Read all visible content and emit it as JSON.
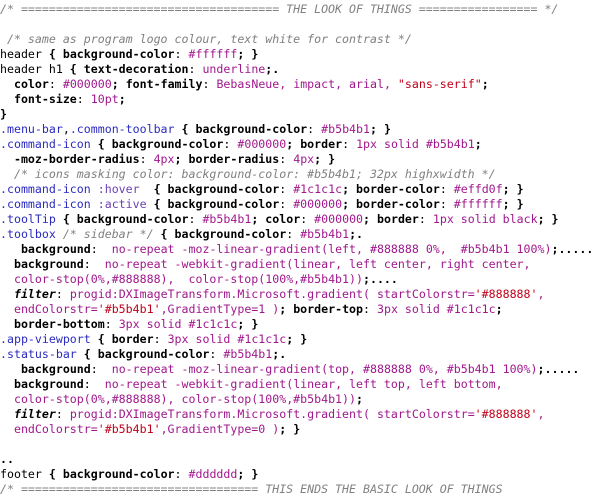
{
  "colors": {
    "comment": "#808080",
    "class_selector": "#2b2bbf",
    "pseudo": "#6a3fb5",
    "value": "#a0188d",
    "string": "#c0001a",
    "background": "#ffffff"
  },
  "lines": [
    [
      [
        "comment",
        "/* ===================================== THE LOOK OF THINGS ================= */"
      ]
    ],
    [],
    [
      [
        "plain",
        " "
      ],
      [
        "comment",
        "/* same as program logo colour, text white for contrast */"
      ]
    ],
    [
      [
        "selector",
        "header"
      ],
      [
        "punct",
        " { "
      ],
      [
        "prop",
        "background-color"
      ],
      [
        "plain",
        ": "
      ],
      [
        "value",
        "#ffffff"
      ],
      [
        "punct",
        "; }"
      ]
    ],
    [
      [
        "selector",
        "header h1"
      ],
      [
        "punct",
        " { "
      ],
      [
        "prop",
        "text-decoration"
      ],
      [
        "plain",
        ": "
      ],
      [
        "value",
        "underline"
      ],
      [
        "punct",
        ";"
      ],
      [
        "ws-dots",
        "."
      ]
    ],
    [
      [
        "plain",
        "  "
      ],
      [
        "prop",
        "color"
      ],
      [
        "plain",
        ": "
      ],
      [
        "value",
        "#000000"
      ],
      [
        "punct",
        "; "
      ],
      [
        "prop",
        "font-family"
      ],
      [
        "plain",
        ": "
      ],
      [
        "value",
        "BebasNeue, impact, arial, "
      ],
      [
        "string",
        "\"sans-serif\""
      ],
      [
        "punct",
        ";"
      ]
    ],
    [
      [
        "plain",
        "  "
      ],
      [
        "prop",
        "font-size"
      ],
      [
        "plain",
        ": "
      ],
      [
        "value",
        "10pt"
      ],
      [
        "punct",
        ";"
      ]
    ],
    [
      [
        "punct",
        "}"
      ]
    ],
    [
      [
        "class",
        ".menu-bar"
      ],
      [
        "plain",
        ","
      ],
      [
        "class",
        ".common-toolbar"
      ],
      [
        "punct",
        " { "
      ],
      [
        "prop",
        "background-color"
      ],
      [
        "plain",
        ": "
      ],
      [
        "value",
        "#b5b4b1"
      ],
      [
        "punct",
        "; }"
      ]
    ],
    [
      [
        "class",
        ".command-icon"
      ],
      [
        "punct",
        " { "
      ],
      [
        "prop",
        "background-color"
      ],
      [
        "plain",
        ": "
      ],
      [
        "value",
        "#000000"
      ],
      [
        "punct",
        "; "
      ],
      [
        "prop",
        "border"
      ],
      [
        "plain",
        ": "
      ],
      [
        "value",
        "1px solid #b5b4b1"
      ],
      [
        "punct",
        ";"
      ]
    ],
    [
      [
        "plain",
        "  "
      ],
      [
        "prop",
        "-moz-border-radius"
      ],
      [
        "plain",
        ": "
      ],
      [
        "value",
        "4px"
      ],
      [
        "punct",
        "; "
      ],
      [
        "prop",
        "border-radius"
      ],
      [
        "plain",
        ": "
      ],
      [
        "value",
        "4px"
      ],
      [
        "punct",
        "; }"
      ]
    ],
    [
      [
        "plain",
        "  "
      ],
      [
        "comment",
        "/* icons masking color: background-color: #b5b4b1; 32px highxwidth */"
      ]
    ],
    [
      [
        "class",
        ".command-icon"
      ],
      [
        "pseudo",
        " :hover"
      ],
      [
        "punct",
        "  { "
      ],
      [
        "prop",
        "background-color"
      ],
      [
        "plain",
        ": "
      ],
      [
        "value",
        "#1c1c1c"
      ],
      [
        "punct",
        "; "
      ],
      [
        "prop",
        "border-color"
      ],
      [
        "plain",
        ": "
      ],
      [
        "value",
        "#effd0f"
      ],
      [
        "punct",
        "; }"
      ]
    ],
    [
      [
        "class",
        ".command-icon"
      ],
      [
        "pseudo",
        " :active"
      ],
      [
        "punct",
        " { "
      ],
      [
        "prop",
        "background-color"
      ],
      [
        "plain",
        ": "
      ],
      [
        "value",
        "#000000"
      ],
      [
        "punct",
        "; "
      ],
      [
        "prop",
        "border-color"
      ],
      [
        "plain",
        ": "
      ],
      [
        "value",
        "#ffffff"
      ],
      [
        "punct",
        "; }"
      ]
    ],
    [
      [
        "class",
        ".toolTip"
      ],
      [
        "punct",
        " { "
      ],
      [
        "prop",
        "background-color"
      ],
      [
        "plain",
        ": "
      ],
      [
        "value",
        "#b5b4b1"
      ],
      [
        "punct",
        "; "
      ],
      [
        "prop",
        "color"
      ],
      [
        "plain",
        ": "
      ],
      [
        "value",
        "#000000"
      ],
      [
        "punct",
        "; "
      ],
      [
        "prop",
        "border"
      ],
      [
        "plain",
        ": "
      ],
      [
        "value",
        "1px solid black"
      ],
      [
        "punct",
        "; }"
      ]
    ],
    [
      [
        "class",
        ".toolbox"
      ],
      [
        "plain",
        " "
      ],
      [
        "comment",
        "/* sidebar */"
      ],
      [
        "punct",
        " { "
      ],
      [
        "prop",
        "background-color"
      ],
      [
        "plain",
        ": "
      ],
      [
        "value",
        "#b5b4b1"
      ],
      [
        "punct",
        ";"
      ],
      [
        "ws-dots",
        "."
      ]
    ],
    [
      [
        "plain",
        "   "
      ],
      [
        "prop",
        "background"
      ],
      [
        "plain",
        ":  "
      ],
      [
        "value",
        "no-repeat -moz-linear-gradient(left, #888888 0%,  #b5b4b1 100%)"
      ],
      [
        "punct",
        ";"
      ],
      [
        "ws-dots",
        "....."
      ]
    ],
    [
      [
        "plain",
        "  "
      ],
      [
        "prop",
        "background"
      ],
      [
        "plain",
        ":  "
      ],
      [
        "value",
        "no-repeat -webkit-gradient(linear, left center, right center,"
      ]
    ],
    [
      [
        "plain",
        "  "
      ],
      [
        "value",
        "color-stop(0%,#888888),  color-stop(100%,#b5b4b1))"
      ],
      [
        "punct",
        ";"
      ],
      [
        "ws-dots",
        "...."
      ]
    ],
    [
      [
        "plain",
        "  "
      ],
      [
        "prop-italic",
        "filter"
      ],
      [
        "plain",
        ": "
      ],
      [
        "value",
        "progid:DXImageTransform.Microsoft.gradient( startColorstr="
      ],
      [
        "string",
        "'#888888'"
      ],
      [
        "value",
        ","
      ]
    ],
    [
      [
        "plain",
        "  "
      ],
      [
        "value",
        "endColorstr="
      ],
      [
        "string",
        "'#b5b4b1'"
      ],
      [
        "value",
        ",GradientType=1 )"
      ],
      [
        "punct",
        "; "
      ],
      [
        "prop",
        "border-top"
      ],
      [
        "plain",
        ": "
      ],
      [
        "value",
        "3px solid #1c1c1c"
      ],
      [
        "punct",
        ";"
      ]
    ],
    [
      [
        "plain",
        "  "
      ],
      [
        "prop",
        "border-bottom"
      ],
      [
        "plain",
        ": "
      ],
      [
        "value",
        "3px solid #1c1c1c"
      ],
      [
        "punct",
        "; }"
      ]
    ],
    [
      [
        "class",
        ".app-viewport"
      ],
      [
        "punct",
        " { "
      ],
      [
        "prop",
        "border"
      ],
      [
        "plain",
        ": "
      ],
      [
        "value",
        "3px solid #1c1c1c"
      ],
      [
        "punct",
        "; }"
      ]
    ],
    [
      [
        "class",
        ".status-bar"
      ],
      [
        "punct",
        " { "
      ],
      [
        "prop",
        "background-color"
      ],
      [
        "plain",
        ": "
      ],
      [
        "value",
        "#b5b4b1"
      ],
      [
        "punct",
        ";"
      ],
      [
        "ws-dots",
        "."
      ]
    ],
    [
      [
        "plain",
        "   "
      ],
      [
        "prop",
        "background"
      ],
      [
        "plain",
        ":  "
      ],
      [
        "value",
        "no-repeat -moz-linear-gradient(top, #888888 0%, #b5b4b1 100%)"
      ],
      [
        "punct",
        ";"
      ],
      [
        "ws-dots",
        "....."
      ]
    ],
    [
      [
        "plain",
        "  "
      ],
      [
        "prop",
        "background"
      ],
      [
        "plain",
        ":  "
      ],
      [
        "value",
        "no-repeat -webkit-gradient(linear, left top, left bottom,"
      ]
    ],
    [
      [
        "plain",
        "  "
      ],
      [
        "value",
        "color-stop(0%,#888888), color-stop(100%,#b5b4b1))"
      ],
      [
        "punct",
        ";"
      ]
    ],
    [
      [
        "plain",
        "  "
      ],
      [
        "prop-italic",
        "filter"
      ],
      [
        "plain",
        ": "
      ],
      [
        "value",
        "progid:DXImageTransform.Microsoft.gradient( startColorstr="
      ],
      [
        "string",
        "'#888888'"
      ],
      [
        "value",
        ","
      ]
    ],
    [
      [
        "plain",
        "  "
      ],
      [
        "value",
        "endColorstr="
      ],
      [
        "string",
        "'#b5b4b1'"
      ],
      [
        "value",
        ",GradientType=0 )"
      ],
      [
        "punct",
        "; }"
      ]
    ],
    [],
    [
      [
        "ws-dots",
        ".."
      ]
    ],
    [
      [
        "selector",
        "footer"
      ],
      [
        "punct",
        " { "
      ],
      [
        "prop",
        "background-color"
      ],
      [
        "plain",
        ": "
      ],
      [
        "value",
        "#dddddd"
      ],
      [
        "punct",
        "; }"
      ]
    ],
    [
      [
        "comment",
        "/* ================================== THIS ENDS THE BASIC LOOK OF THINGS"
      ]
    ]
  ]
}
